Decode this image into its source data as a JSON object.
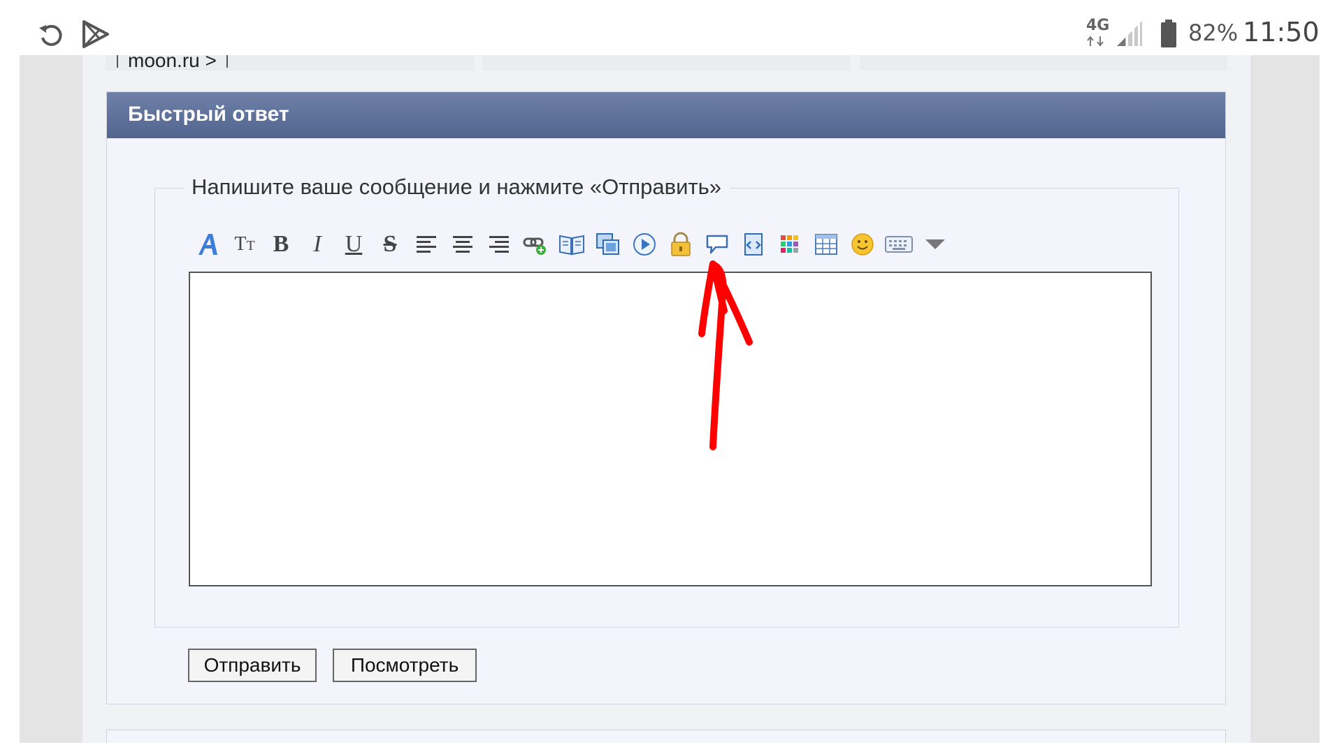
{
  "status_bar": {
    "left_icons": [
      "rotate-icon",
      "play-store-icon"
    ],
    "network": "4G",
    "battery_percent": "82%",
    "time": "11:50"
  },
  "breadcrumb": {
    "text": "moon.ru",
    "separator": ">"
  },
  "quick_reply": {
    "title": "Быстрый ответ",
    "legend": "Напишите ваше сообщение и нажмите «Отправить»",
    "toolbar_icons": [
      "font-color-icon",
      "font-size-icon",
      "bold-icon",
      "italic-icon",
      "underline-icon",
      "strikethrough-icon",
      "align-left-icon",
      "align-center-icon",
      "align-right-icon",
      "insert-link-icon",
      "book-icon",
      "insert-image-icon",
      "video-play-icon",
      "lock-icon",
      "speech-bubble-icon",
      "code-icon",
      "color-palette-icon",
      "table-icon",
      "smiley-icon",
      "keyboard-icon",
      "more-dropdown-icon"
    ],
    "editor_value": "",
    "submit_label": "Отправить",
    "preview_label": "Посмотреть"
  },
  "annotation": {
    "color": "#ff0000",
    "type": "hand-drawn-arrow"
  }
}
